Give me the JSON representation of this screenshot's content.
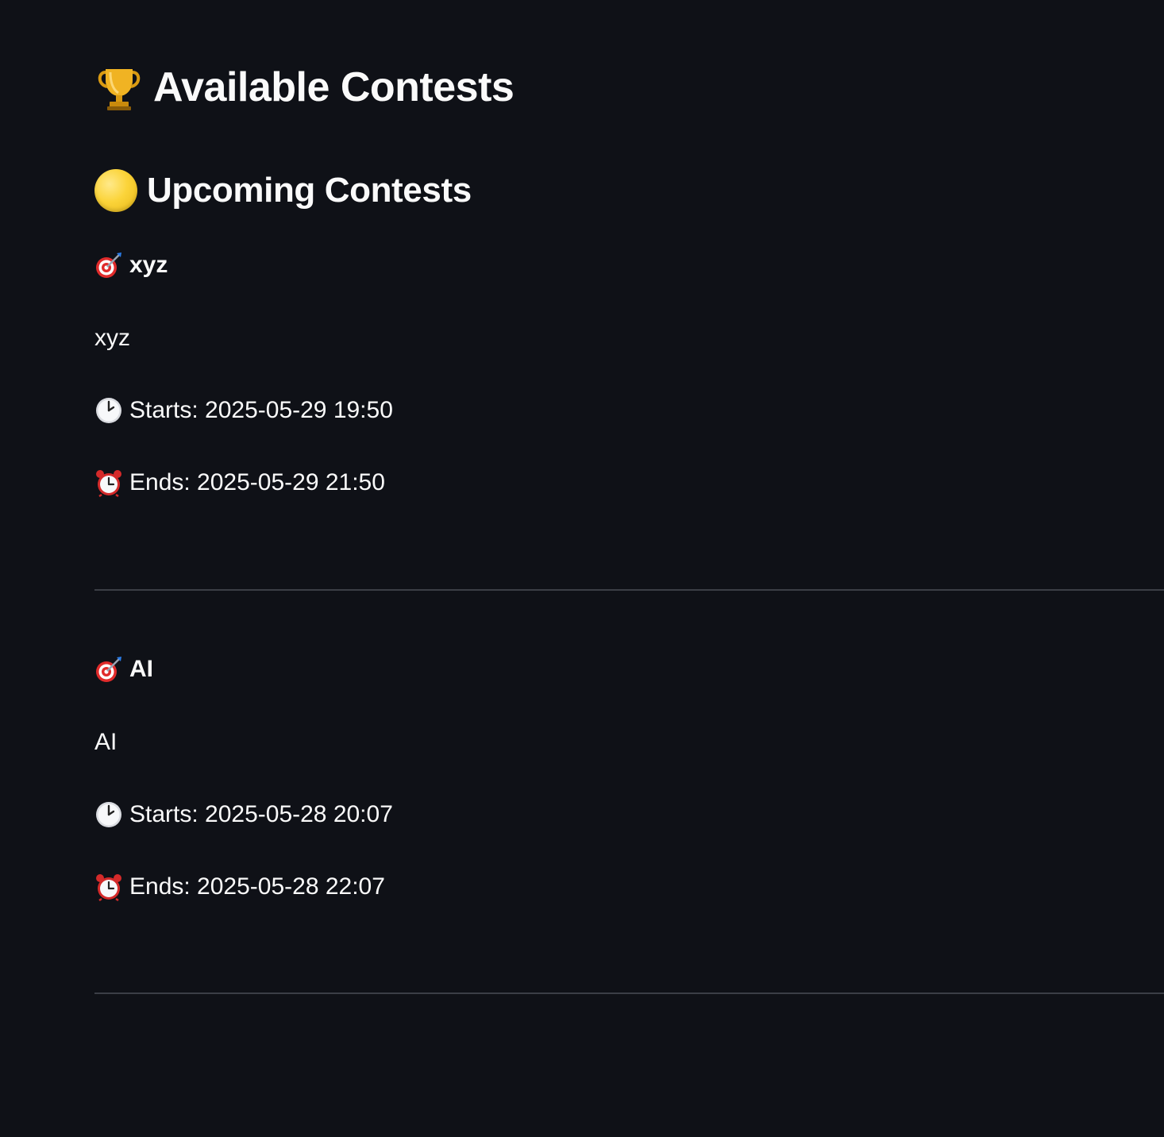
{
  "page": {
    "title": "Available Contests",
    "title_icon": "trophy-icon",
    "section_title": "Upcoming Contests",
    "section_icon": "yellow-circle-icon"
  },
  "contests": [
    {
      "name": "xyz",
      "description": "xyz",
      "starts": "Starts: 2025-05-29 19:50",
      "ends": "Ends: 2025-05-29 21:50"
    },
    {
      "name": "AI",
      "description": "AI",
      "starts": "Starts: 2025-05-28 20:07",
      "ends": "Ends: 2025-05-28 22:07"
    }
  ],
  "colors": {
    "background": "#0f1117",
    "text": "#fafafa",
    "divider": "#3b3e46"
  }
}
